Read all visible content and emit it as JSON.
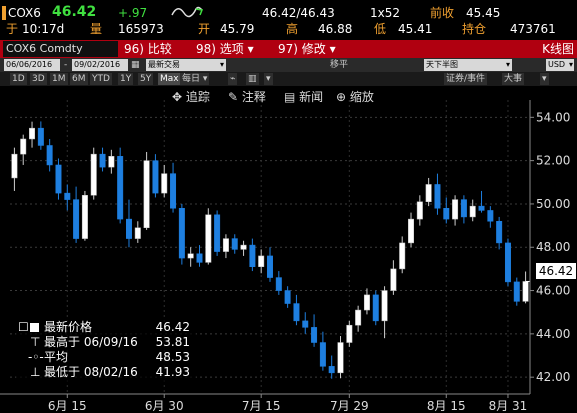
{
  "ticker": {
    "symbol": "COX6",
    "last": "46.42",
    "change": "+.97",
    "bid_ask": "46.42/46.43",
    "size": "1x52",
    "prev_close_label": "前收",
    "prev_close": "45.45",
    "time_label": "于",
    "time": "10:17d",
    "volume_label": "量",
    "volume": "165973",
    "open_label": "开",
    "open": "45.79",
    "high_label": "高",
    "high": "46.88",
    "low_label": "低",
    "low": "45.41",
    "oi_label": "持仓",
    "open_interest": "473761"
  },
  "titlebar": {
    "symbol": "COX6 Comdty",
    "compare_num": "96)",
    "compare_label": "比较",
    "options_num": "98)",
    "options_label": "选项",
    "edit_num": "97)",
    "edit_label": "修改",
    "graph_type": "K线图"
  },
  "settings": {
    "start_date": "06/06/2016",
    "end_date": "09/02/2016",
    "price_type": "最新交易",
    "quantity_label": "移平",
    "frequency": "天下半图",
    "currency": "USD"
  },
  "ranges": [
    "1D",
    "3D",
    "1M",
    "6M",
    "YTD",
    "1Y",
    "5Y",
    "Max"
  ],
  "period": "每日",
  "toolbar": {
    "track": "追踪",
    "annotate": "注释",
    "news": "新闻",
    "zoom": "缩放",
    "securities_events": "证券/事件",
    "event_size": "大事"
  },
  "legend": {
    "last_label": "最新价格",
    "last_value": "46.42",
    "high_label": "最高于 06/09/16",
    "high_value": "53.81",
    "avg_label": "平均",
    "avg_value": "48.53",
    "low_label": "最低于 08/02/16",
    "low_value": "41.93"
  },
  "last_tag": "46.42",
  "colors": {
    "up": "#ffffff",
    "down": "#1e7fe0",
    "brand_red": "#b00010",
    "accent_amber": "#f0a030"
  },
  "chart_data": {
    "type": "candlestick",
    "x_tick_labels": [
      "6月 15",
      "6月 30",
      "7月 15",
      "7月 29",
      "8月 15",
      "8月 31"
    ],
    "y_tick_labels": [
      "42.00",
      "44.00",
      "46.00",
      "48.00",
      "50.00",
      "52.00",
      "54.00"
    ],
    "ylim": [
      41.5,
      54.8
    ],
    "grid": true,
    "candles": [
      {
        "o": 51.2,
        "h": 52.6,
        "l": 50.6,
        "c": 52.3
      },
      {
        "o": 52.3,
        "h": 53.2,
        "l": 51.8,
        "c": 53.0
      },
      {
        "o": 53.0,
        "h": 53.8,
        "l": 52.6,
        "c": 53.5
      },
      {
        "o": 53.5,
        "h": 53.81,
        "l": 52.5,
        "c": 52.7
      },
      {
        "o": 52.7,
        "h": 53.0,
        "l": 51.5,
        "c": 51.8
      },
      {
        "o": 51.8,
        "h": 52.1,
        "l": 50.2,
        "c": 50.5
      },
      {
        "o": 50.5,
        "h": 50.9,
        "l": 49.7,
        "c": 50.2
      },
      {
        "o": 50.2,
        "h": 50.8,
        "l": 48.2,
        "c": 48.4
      },
      {
        "o": 48.4,
        "h": 50.6,
        "l": 48.3,
        "c": 50.4
      },
      {
        "o": 50.4,
        "h": 52.6,
        "l": 50.2,
        "c": 52.3
      },
      {
        "o": 52.3,
        "h": 52.6,
        "l": 51.5,
        "c": 51.7
      },
      {
        "o": 51.7,
        "h": 52.5,
        "l": 51.4,
        "c": 52.2
      },
      {
        "o": 52.2,
        "h": 52.6,
        "l": 49.1,
        "c": 49.3
      },
      {
        "o": 49.3,
        "h": 50.2,
        "l": 48.0,
        "c": 48.4
      },
      {
        "o": 48.4,
        "h": 49.2,
        "l": 48.2,
        "c": 48.9
      },
      {
        "o": 48.9,
        "h": 52.4,
        "l": 48.8,
        "c": 52.0
      },
      {
        "o": 52.0,
        "h": 52.3,
        "l": 50.3,
        "c": 50.5
      },
      {
        "o": 50.5,
        "h": 51.8,
        "l": 50.3,
        "c": 51.4
      },
      {
        "o": 51.4,
        "h": 51.9,
        "l": 49.6,
        "c": 49.8
      },
      {
        "o": 49.8,
        "h": 50.0,
        "l": 47.2,
        "c": 47.5
      },
      {
        "o": 47.5,
        "h": 48.0,
        "l": 47.1,
        "c": 47.7
      },
      {
        "o": 47.7,
        "h": 48.1,
        "l": 47.1,
        "c": 47.3
      },
      {
        "o": 47.3,
        "h": 49.8,
        "l": 47.2,
        "c": 49.5
      },
      {
        "o": 49.5,
        "h": 49.7,
        "l": 47.6,
        "c": 47.8
      },
      {
        "o": 47.8,
        "h": 48.6,
        "l": 47.5,
        "c": 48.4
      },
      {
        "o": 48.4,
        "h": 48.6,
        "l": 47.7,
        "c": 47.9
      },
      {
        "o": 47.9,
        "h": 48.3,
        "l": 47.6,
        "c": 48.1
      },
      {
        "o": 48.1,
        "h": 48.4,
        "l": 46.9,
        "c": 47.1
      },
      {
        "o": 47.1,
        "h": 47.9,
        "l": 46.8,
        "c": 47.6
      },
      {
        "o": 47.6,
        "h": 48.0,
        "l": 46.4,
        "c": 46.6
      },
      {
        "o": 46.6,
        "h": 46.9,
        "l": 45.8,
        "c": 46.0
      },
      {
        "o": 46.0,
        "h": 46.2,
        "l": 45.2,
        "c": 45.4
      },
      {
        "o": 45.4,
        "h": 45.8,
        "l": 44.4,
        "c": 44.6
      },
      {
        "o": 44.6,
        "h": 45.0,
        "l": 44.0,
        "c": 44.3
      },
      {
        "o": 44.3,
        "h": 44.9,
        "l": 43.4,
        "c": 43.6
      },
      {
        "o": 43.6,
        "h": 44.1,
        "l": 42.3,
        "c": 42.5
      },
      {
        "o": 42.5,
        "h": 43.0,
        "l": 41.93,
        "c": 42.2
      },
      {
        "o": 42.2,
        "h": 43.9,
        "l": 41.95,
        "c": 43.6
      },
      {
        "o": 43.6,
        "h": 44.6,
        "l": 43.4,
        "c": 44.4
      },
      {
        "o": 44.4,
        "h": 45.3,
        "l": 44.1,
        "c": 45.1
      },
      {
        "o": 45.1,
        "h": 46.1,
        "l": 44.9,
        "c": 45.8
      },
      {
        "o": 45.8,
        "h": 46.0,
        "l": 44.4,
        "c": 44.6
      },
      {
        "o": 44.6,
        "h": 46.2,
        "l": 43.8,
        "c": 46.0
      },
      {
        "o": 46.0,
        "h": 47.4,
        "l": 45.8,
        "c": 47.0
      },
      {
        "o": 47.0,
        "h": 48.5,
        "l": 46.8,
        "c": 48.2
      },
      {
        "o": 48.2,
        "h": 49.6,
        "l": 48.0,
        "c": 49.3
      },
      {
        "o": 49.3,
        "h": 50.4,
        "l": 49.0,
        "c": 50.1
      },
      {
        "o": 50.1,
        "h": 51.2,
        "l": 49.9,
        "c": 50.9
      },
      {
        "o": 50.9,
        "h": 51.4,
        "l": 49.5,
        "c": 49.8
      },
      {
        "o": 49.8,
        "h": 50.3,
        "l": 49.1,
        "c": 49.3
      },
      {
        "o": 49.3,
        "h": 50.4,
        "l": 49.0,
        "c": 50.2
      },
      {
        "o": 50.2,
        "h": 50.4,
        "l": 49.1,
        "c": 49.4
      },
      {
        "o": 49.4,
        "h": 50.2,
        "l": 49.2,
        "c": 49.9
      },
      {
        "o": 49.9,
        "h": 50.6,
        "l": 49.6,
        "c": 49.7
      },
      {
        "o": 49.7,
        "h": 49.9,
        "l": 48.9,
        "c": 49.2
      },
      {
        "o": 49.2,
        "h": 49.4,
        "l": 47.9,
        "c": 48.2
      },
      {
        "o": 48.2,
        "h": 48.4,
        "l": 46.2,
        "c": 46.4
      },
      {
        "o": 46.4,
        "h": 46.6,
        "l": 45.3,
        "c": 45.5
      },
      {
        "o": 45.5,
        "h": 46.88,
        "l": 45.41,
        "c": 46.42
      }
    ]
  }
}
